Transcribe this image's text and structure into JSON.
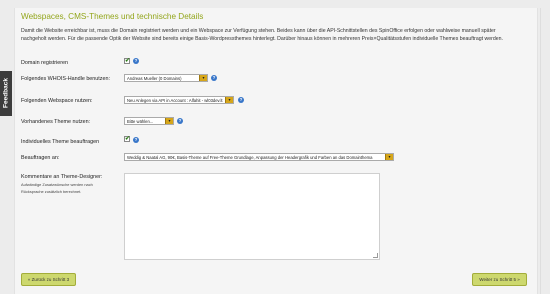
{
  "feedback_label": "Feedback",
  "section_title": "Webspaces, CMS-Themes und technische Details",
  "intro_text": "Damit die Website erreichbar ist, muss die Domain registriert werden und ein Webspace zur Verfügung stehen. Beides kann über die API-Schnittstellen des SpinOffice erfolgen oder wahlweise manuell später nachgeholt werden. Für die passende Optik der Website sind bereits einige Basis-Wordpressthemes hinterlegt. Darüber hinaus können in mehreren Preis×Qualitätsstufen individuelle Themes beauftragt werden.",
  "fields": {
    "domain_registrieren": {
      "label": "Domain registrieren",
      "checked": true
    },
    "whois_handle": {
      "label": "Folgendes WHOIS-Handle benutzen:",
      "value": "Andreas Mueller (0 Domains)"
    },
    "webspace": {
      "label": "Folgenden Webspace nutzen:",
      "value": "Neu Anlegen via API in Account : Alfahit - wl03dev.lt"
    },
    "theme": {
      "label": "Vorhandenes Theme nutzen:",
      "value": "Bitte wählen..."
    },
    "individuelles_theme": {
      "label": "Individuelles Theme beauftragen",
      "checked": true
    },
    "beauftragen_an": {
      "label": "Beauftragen an:",
      "value": "Weddig & Naatal AG, 90€, Basis-Theme auf Free-Theme Grundlage, Anpassung der Headergrafik und Farben an das Domainthema"
    },
    "kommentar": {
      "label": "Kommentare an Theme-Designer:",
      "hint": "Aufwändige Zusatzwünsche werden nach Rücksprache zusätzlich berechnet.",
      "value": ""
    }
  },
  "buttons": {
    "back": "« Zurück zu Schritt 3",
    "next": "Weiter zu Schritt 5 »"
  },
  "colors": {
    "title": "#93a61c",
    "button_bg": "#cdd86e",
    "select_arrow": "#d6a61a",
    "help_icon": "#3876c9"
  }
}
